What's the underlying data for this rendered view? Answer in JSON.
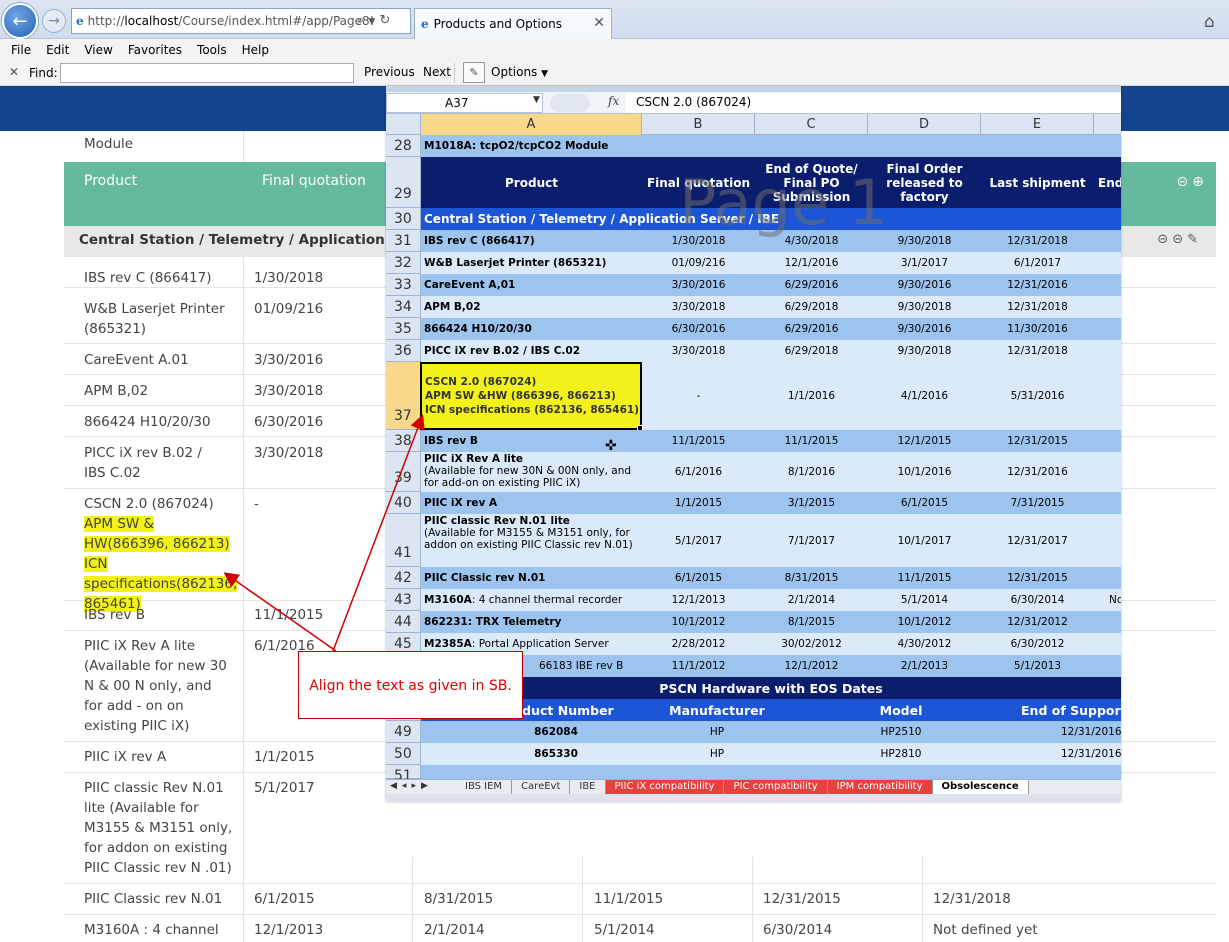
{
  "browser": {
    "address_prefix": "http://",
    "address_host": "localhost",
    "address_path": "/Course/index.html#/app/Page8!",
    "tab_title": "Products and Options"
  },
  "menu": [
    "File",
    "Edit",
    "View",
    "Favorites",
    "Tools",
    "Help"
  ],
  "find": {
    "label": "Find:",
    "value": "",
    "previous": "Previous",
    "next": "Next",
    "options": "Options"
  },
  "page": {
    "module_label": "Module",
    "headers": [
      "Product",
      "Final quotation"
    ],
    "section_title": "Central Station / Telemetry / Application Server / IBE",
    "rows": [
      {
        "product": "IBS rev C (866417)",
        "final_quotation": "1/30/2018"
      },
      {
        "product": "W&B Laserjet Printer (865321)",
        "final_quotation": "01/09/216"
      },
      {
        "product": "CareEvent A.01",
        "final_quotation": "3/30/2016"
      },
      {
        "product": "APM B,02",
        "final_quotation": "3/30/2018"
      },
      {
        "product": "866424 H10/20/30",
        "final_quotation": "6/30/2016"
      },
      {
        "product": "PICC iX rev B.02 / IBS C.02",
        "final_quotation": "3/30/2018"
      },
      {
        "product_plain": "CSCN 2.0 (867024) ",
        "product_highlight": "APM SW & HW(866396, 866213) ICN specifications(862136, 865461)",
        "final_quotation": "-"
      },
      {
        "product": "IBS rev B",
        "final_quotation": "11/1/2015"
      },
      {
        "product": "PIIC iX Rev A lite (Available for new 30 N & 00 N only, and for add - on on existing PIIC iX)",
        "final_quotation": "6/1/2016"
      },
      {
        "product": "PIIC iX rev A",
        "final_quotation": "1/1/2015"
      },
      {
        "product": "PIIC classic Rev N.01 lite (Available for M3155 & M3151 only, for addon on existing PIIC Classic rev N .01)",
        "final_quotation": "5/1/2017"
      },
      {
        "product": "PIIC Classic rev N.01",
        "final_quotation": "6/1/2015",
        "end_of_quote": "8/31/2015",
        "final_order": "11/1/2015",
        "last_shipment": "12/31/2015",
        "end_of_support": "12/31/2018"
      },
      {
        "product": "M3160A : 4 channel",
        "final_quotation": "12/1/2013",
        "end_of_quote": "2/1/2014",
        "final_order": "5/1/2014",
        "last_shipment": "6/30/2014",
        "end_of_support": "Not defined yet"
      }
    ]
  },
  "sheet": {
    "name_box": "A37",
    "fx": "fx",
    "formula": "CSCN 2.0 (867024)",
    "columns": [
      "A",
      "B",
      "C",
      "D",
      "E"
    ],
    "watermark": "Page 1",
    "row28": "M1018A: tcpO2/tcpCO2 Module",
    "header": {
      "product": "Product",
      "final_quotation": "Final quotation",
      "end_of_quote": "End of Quote/ Final PO Submission",
      "final_order": "Final Order released to factory",
      "last_shipment": "Last shipment",
      "end_partial": "End"
    },
    "section": "Central Station / Telemetry / Application Server / IBE",
    "rows": [
      {
        "num": "31",
        "a": "IBS rev C (866417)",
        "b": "1/30/2018",
        "c": "4/30/2018",
        "d": "9/30/2018",
        "e": "12/31/2018"
      },
      {
        "num": "32",
        "a": "W&B Laserjet Printer (865321)",
        "b": "01/09/216",
        "c": "12/1/2016",
        "d": "3/1/2017",
        "e": "6/1/2017"
      },
      {
        "num": "33",
        "a": "CareEvent A,01",
        "b": "3/30/2016",
        "c": "6/29/2016",
        "d": "9/30/2016",
        "e": "12/31/2016"
      },
      {
        "num": "34",
        "a": "APM B,02",
        "b": "3/30/2018",
        "c": "6/29/2018",
        "d": "9/30/2018",
        "e": "12/31/2018"
      },
      {
        "num": "35",
        "a": "866424 H10/20/30",
        "b": "6/30/2016",
        "c": "6/29/2016",
        "d": "9/30/2016",
        "e": "11/30/2016"
      },
      {
        "num": "36",
        "a": "PICC iX rev B.02 / IBS C.02",
        "b": "3/30/2018",
        "c": "6/29/2018",
        "d": "9/30/2018",
        "e": "12/31/2018"
      },
      {
        "num": "37",
        "a1": "CSCN 2.0 (867024)",
        "a2": "APM SW &HW  (866396, 866213)",
        "a3": "ICN specifications (862136, 865461)",
        "b": "-",
        "c": "1/1/2016",
        "d": "4/1/2016",
        "e": "5/31/2016"
      },
      {
        "num": "38",
        "a": "IBS rev B",
        "b": "11/1/2015",
        "c": "11/1/2015",
        "d": "12/1/2015",
        "e": "12/31/2015"
      },
      {
        "num": "39",
        "a": "PIIC iX Rev A lite",
        "a_note": "(Available for new 30N & 00N only, and for add-on on existing PIIC iX)",
        "b": "6/1/2016",
        "c": "8/1/2016",
        "d": "10/1/2016",
        "e": "12/31/2016"
      },
      {
        "num": "40",
        "a": "PIIC iX rev A",
        "b": "1/1/2015",
        "c": "3/1/2015",
        "d": "6/1/2015",
        "e": "7/31/2015"
      },
      {
        "num": "41",
        "a": "PIIC classic Rev N.01 lite",
        "a_note": "(Available for M3155 & M3151 only, for addon on existing PIIC Classic rev N.01)",
        "b": "5/1/2017",
        "c": "7/1/2017",
        "d": "10/1/2017",
        "e": "12/31/2017"
      },
      {
        "num": "42",
        "a": "PIIC Classic rev N.01",
        "b": "6/1/2015",
        "c": "8/31/2015",
        "d": "11/1/2015",
        "e": "12/31/2015"
      },
      {
        "num": "43",
        "a_bold": "M3160A",
        "a_rest": " : 4 channel thermal recorder",
        "b": "12/1/2013",
        "c": "2/1/2014",
        "d": "5/1/2014",
        "e": "6/30/2014",
        "f": "No"
      },
      {
        "num": "44",
        "a_bold": "862231",
        "a_rest": " : TRX Telemetry",
        "b": "10/1/2012",
        "c": "8/1/2015",
        "d": "10/1/2012",
        "e": "12/31/2012"
      },
      {
        "num": "45",
        "a_bold": "M2385A",
        "a_rest": " : Portal Application Server",
        "b": "2/28/2012",
        "c": "30/02/2012",
        "d": "4/30/2012",
        "e": "6/30/2012"
      },
      {
        "num": "46",
        "a": "66183 IBE rev B",
        "b": "11/1/2012",
        "c": "12/1/2012",
        "d": "2/1/2013",
        "e": "5/1/2013"
      }
    ],
    "pscn_title": "PSCN Hardware with EOS Dates",
    "pscn_headers": [
      "Product Number",
      "Manufacturer",
      "Model",
      "End of Support"
    ],
    "pscn_rows": [
      {
        "num": "49",
        "product": "862084",
        "manufacturer": "HP",
        "model": "HP2510",
        "eos": "12/31/2016"
      },
      {
        "num": "50",
        "product": "865330",
        "manufacturer": "HP",
        "model": "HP2810",
        "eos": "12/31/2016"
      }
    ],
    "tabs": [
      "IBS IEM",
      "CareEvt",
      "IBE",
      "PIIC iX compatibility",
      "PIC compatibility",
      "IPM compatibility",
      "Obsolescence"
    ]
  },
  "callout": "Align the text as given in SB.",
  "colors": {
    "page_header": "#14448d",
    "table_header": "#65b99f",
    "highlight": "#f2f21a",
    "annotation_red": "#e00000"
  }
}
